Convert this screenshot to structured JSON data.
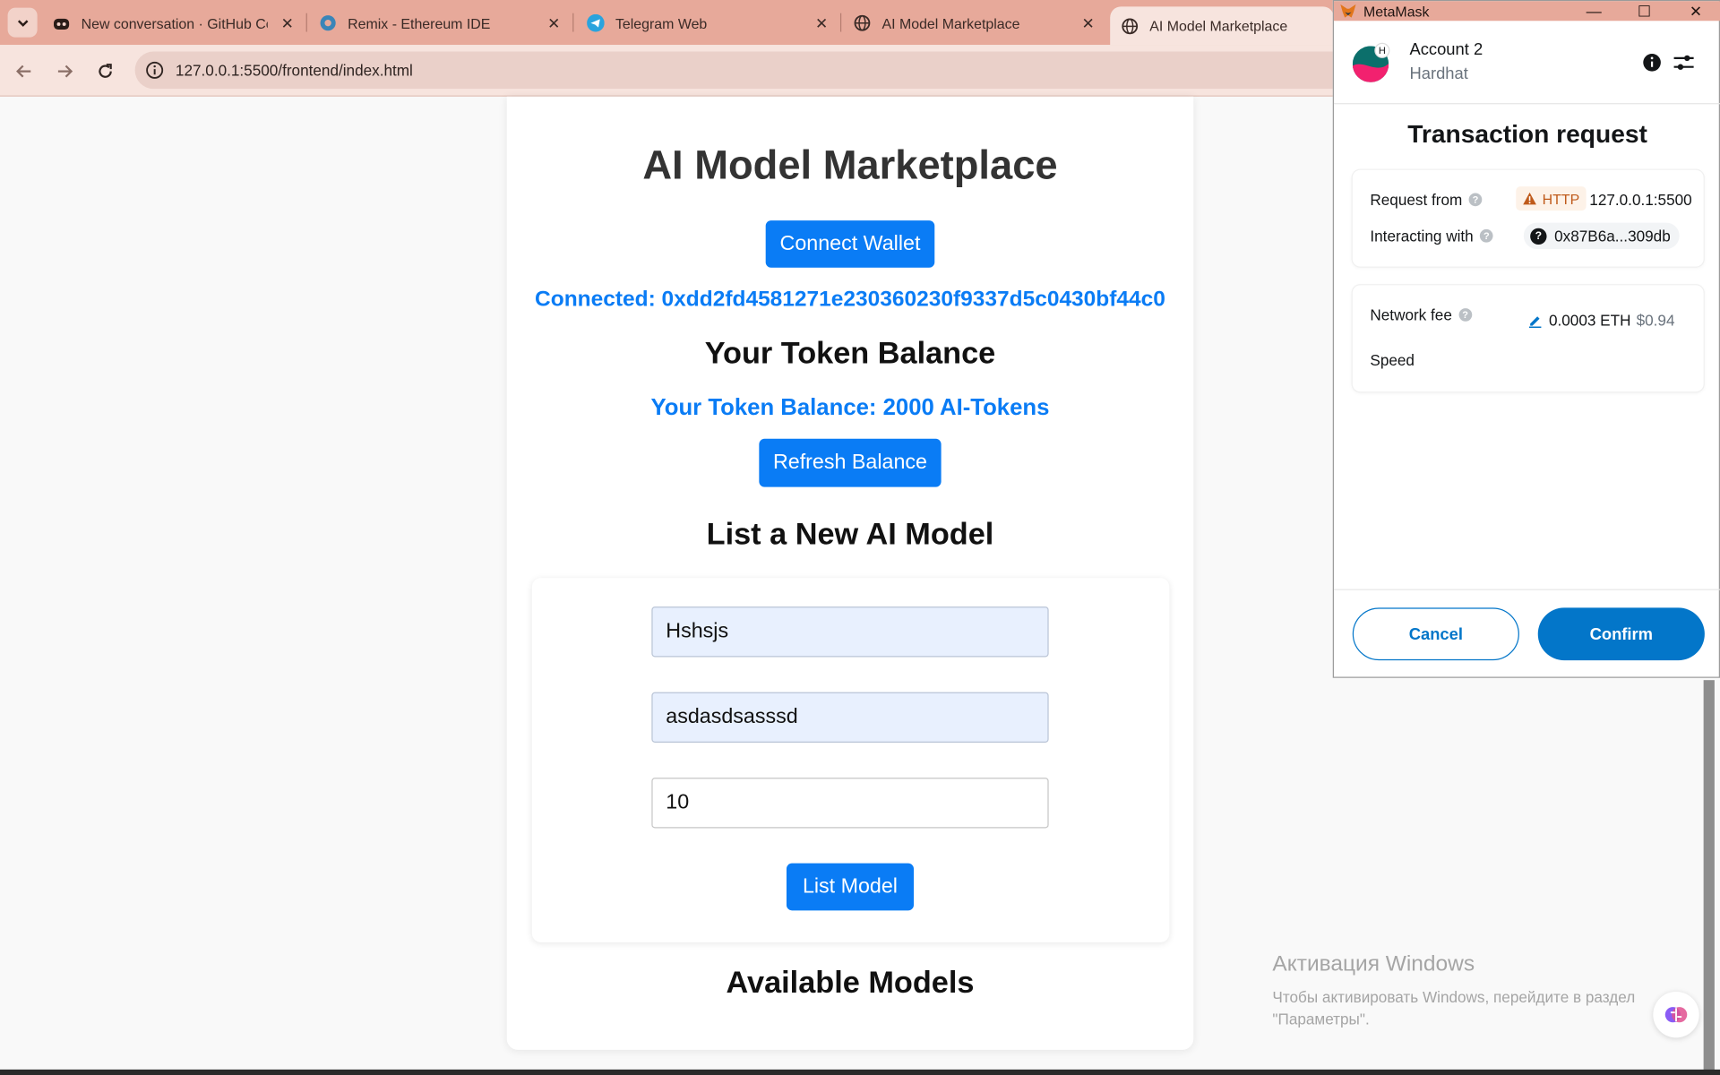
{
  "browser": {
    "tabs": [
      {
        "label": "New conversation · GitHub Cop",
        "icon": "copilot-icon"
      },
      {
        "label": "Remix - Ethereum IDE",
        "icon": "remix-icon"
      },
      {
        "label": "Telegram Web",
        "icon": "telegram-icon"
      },
      {
        "label": "AI Model Marketplace",
        "icon": "globe-icon"
      },
      {
        "label": "AI Model Marketplace",
        "icon": "globe-icon",
        "active": true
      }
    ],
    "url": "127.0.0.1:5500/frontend/index.html"
  },
  "page": {
    "title": "AI Model Marketplace",
    "connect_button": "Connect Wallet",
    "connected_text": "Connected: 0xdd2fd4581271e230360230f9337d5c0430bf44c0",
    "balance_heading": "Your Token Balance",
    "balance_text": "Your Token Balance: 2000 AI-Tokens",
    "refresh_button": "Refresh Balance",
    "list_heading": "List a New AI Model",
    "form": {
      "name_value": "Hshsjs",
      "description_value": "asdasdsasssd",
      "price_value": "10",
      "submit_button": "List Model"
    },
    "available_heading": "Available Models",
    "accent_color": "#0a7cf5"
  },
  "watermark": {
    "line1": "Активация Windows",
    "line2": "Чтобы активировать Windows, перейдите в раздел",
    "line3": "\"Параметры\"."
  },
  "metamask": {
    "window_title": "MetaMask",
    "account_name": "Account 2",
    "network_name": "Hardhat",
    "avatar_letter": "H",
    "heading": "Transaction request",
    "request_from_label": "Request from",
    "protocol_badge": "HTTP",
    "request_origin": "127.0.0.1:5500",
    "interacting_label": "Interacting with",
    "contract_address": "0x87B6a...309db",
    "fee_label": "Network fee",
    "fee_eth": "0.0003 ETH",
    "fee_fiat": "$0.94",
    "speed_label": "Speed",
    "cancel_button": "Cancel",
    "confirm_button": "Confirm",
    "primary_color": "#0376c9"
  }
}
